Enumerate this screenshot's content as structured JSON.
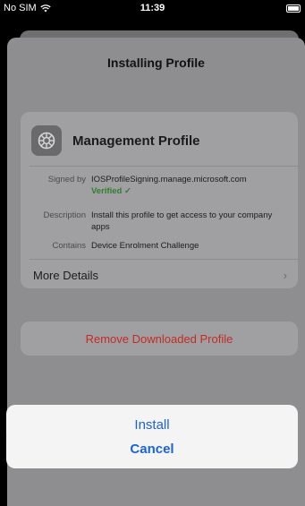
{
  "status_bar": {
    "carrier": "No SIM",
    "time": "11:39",
    "wifi_icon": "wifi-icon",
    "battery_icon": "battery-icon"
  },
  "sheet": {
    "title": "Installing Profile"
  },
  "profile": {
    "name": "Management Profile",
    "icon": "settings-gear-icon",
    "signed_by_label": "Signed by",
    "signed_by_value": "IOSProfileSigning.manage.microsoft.com",
    "verified_text": "Verified ✓",
    "description_label": "Description",
    "description_value": "Install this profile to get access to your company apps",
    "contains_label": "Contains",
    "contains_value": "Device Enrolment Challenge",
    "more_details_label": "More Details",
    "chevron_icon": "chevron-right-icon"
  },
  "actions": {
    "remove_label": "Remove Downloaded Profile",
    "install_label": "Install",
    "cancel_label": "Cancel"
  },
  "colors": {
    "accent_blue": "#1b63d8",
    "destructive_red": "#c42b22",
    "verified_green": "#2f7d2f"
  }
}
